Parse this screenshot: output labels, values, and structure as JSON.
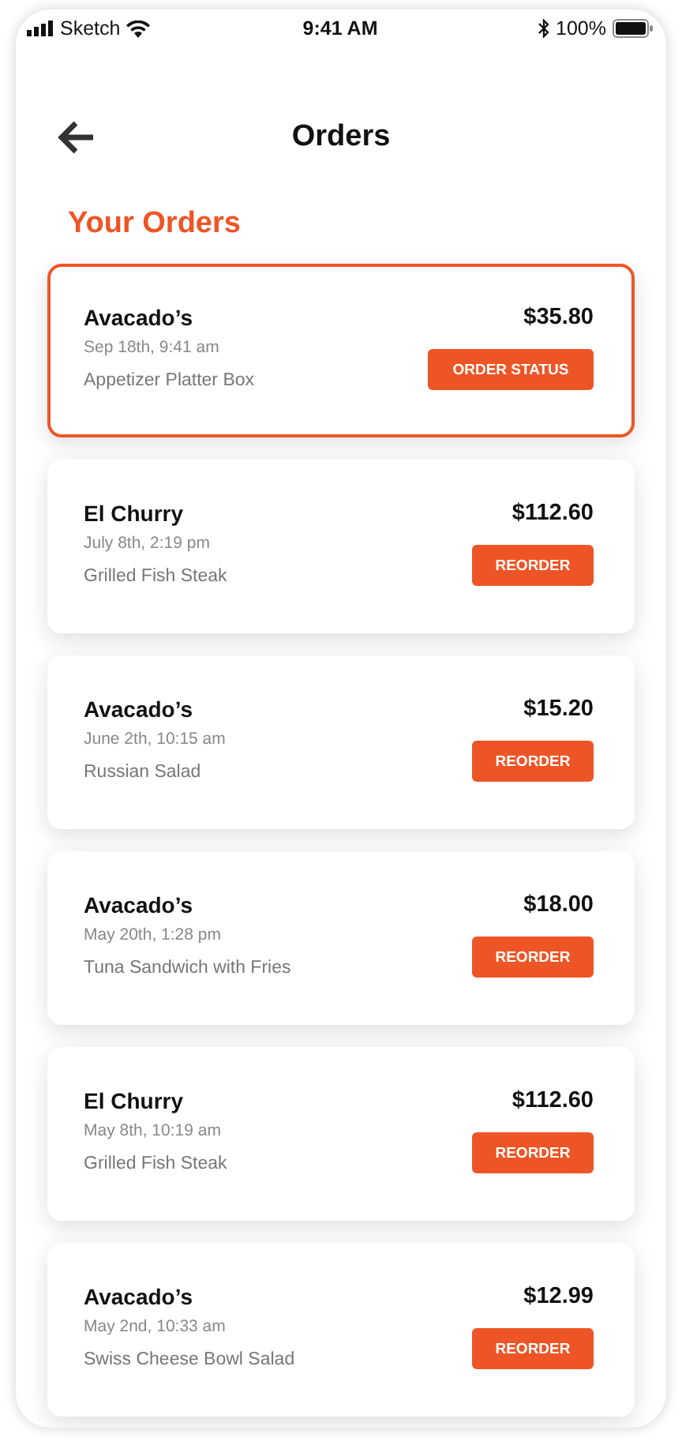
{
  "status_bar": {
    "carrier": "Sketch",
    "time": "9:41 AM",
    "battery": "100%"
  },
  "header": {
    "title": "Orders"
  },
  "section_title": "Your Orders",
  "orders": [
    {
      "restaurant": "Avacado’s",
      "price": "$35.80",
      "date": "Sep 18th, 9:41 am",
      "item": "Appetizer Platter Box",
      "action": "ORDER STATUS",
      "selected": true
    },
    {
      "restaurant": "El Churry",
      "price": "$112.60",
      "date": "July 8th, 2:19 pm",
      "item": "Grilled Fish Steak",
      "action": "REORDER",
      "selected": false
    },
    {
      "restaurant": "Avacado’s",
      "price": "$15.20",
      "date": "June 2th, 10:15 am",
      "item": "Russian Salad",
      "action": "REORDER",
      "selected": false
    },
    {
      "restaurant": "Avacado’s",
      "price": "$18.00",
      "date": "May 20th, 1:28 pm",
      "item": "Tuna Sandwich with Fries",
      "action": "REORDER",
      "selected": false
    },
    {
      "restaurant": "El Churry",
      "price": "$112.60",
      "date": "May 8th, 10:19 am",
      "item": "Grilled Fish Steak",
      "action": "REORDER",
      "selected": false
    },
    {
      "restaurant": "Avacado’s",
      "price": "$12.99",
      "date": "May 2nd, 10:33 am",
      "item": "Swiss Cheese Bowl Salad",
      "action": "REORDER",
      "selected": false
    }
  ]
}
